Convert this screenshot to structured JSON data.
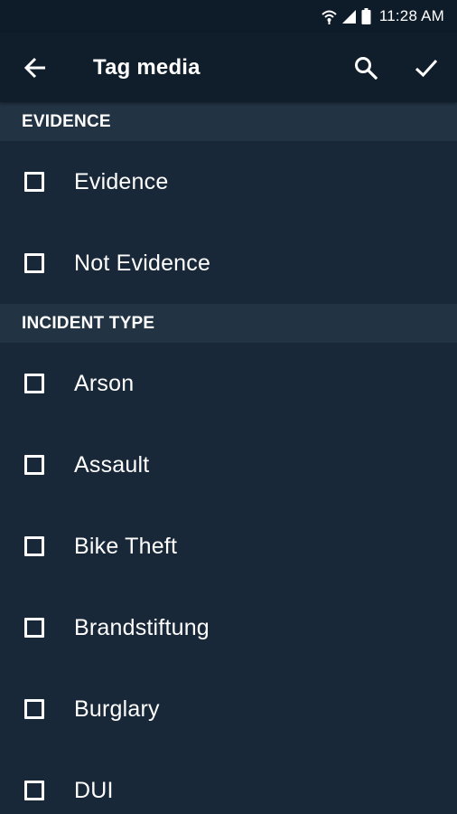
{
  "status_bar": {
    "time": "11:28 AM",
    "icons": [
      "wifi-icon",
      "signal-icon",
      "battery-icon"
    ]
  },
  "app_bar": {
    "title": "Tag media",
    "back_icon": "arrow-back-icon",
    "search_icon": "search-icon",
    "done_icon": "check-icon"
  },
  "sections": [
    {
      "header": "EVIDENCE",
      "items": [
        {
          "label": "Evidence",
          "checked": false
        },
        {
          "label": "Not Evidence",
          "checked": false
        }
      ]
    },
    {
      "header": "INCIDENT TYPE",
      "items": [
        {
          "label": "Arson",
          "checked": false
        },
        {
          "label": "Assault",
          "checked": false
        },
        {
          "label": "Bike Theft",
          "checked": false
        },
        {
          "label": "Brandstiftung",
          "checked": false
        },
        {
          "label": "Burglary",
          "checked": false
        },
        {
          "label": "DUI",
          "checked": false
        }
      ]
    }
  ],
  "colors": {
    "background": "#182838",
    "section_header": "#223444",
    "app_bar": "#101e2c",
    "status_bar": "#0e1b28",
    "foreground": "#ffffff"
  }
}
